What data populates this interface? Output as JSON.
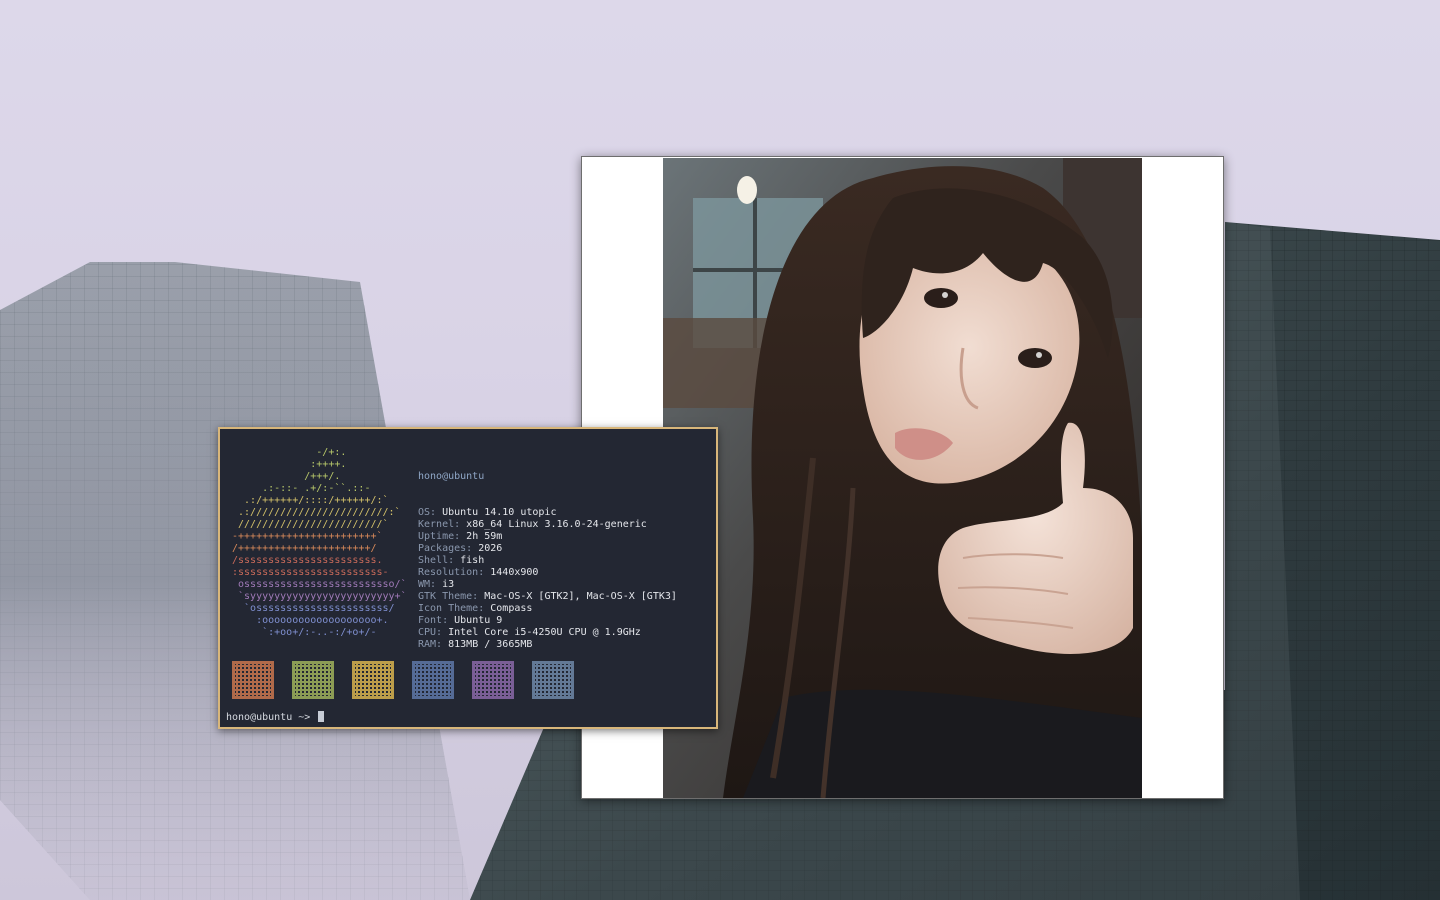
{
  "terminal": {
    "logo_lines": [
      "              -/+:.",
      "             :++++.",
      "            /+++/.",
      "     .:-::- .+/:-``.::-",
      "  .:/++++++/::::/++++++/:`",
      " .:///////////////////////:`",
      " ////////////////////////`",
      "-+++++++++++++++++++++++`",
      "/++++++++++++++++++++++/",
      "/sssssssssssssssssssssss.",
      ":ssssssssssssssssssssssss-",
      " osssssssssssssssssssssssso/`",
      " `syyyyyyyyyyyyyyyyyyyyyyyy+`",
      "  `ossssssssssssssssssssss/",
      "    :ooooooooooooooooooo+.",
      "     `:+oo+/:-..-:/+o+/-"
    ],
    "logo_colors": [
      "#b8c86a",
      "#b8c86a",
      "#b8c86a",
      "#b8c86a",
      "#d4c26a",
      "#d4c26a",
      "#d4c26a",
      "#d88a5a",
      "#d88a5a",
      "#c96a5a",
      "#c96a5a",
      "#a07ab8",
      "#a07ab8",
      "#7f8fd0",
      "#7f8fd0",
      "#7f8fd0"
    ],
    "header": "hono@ubuntu",
    "info": [
      {
        "key": "OS:",
        "value": "Ubuntu 14.10 utopic"
      },
      {
        "key": "Kernel:",
        "value": "x86_64 Linux 3.16.0-24-generic"
      },
      {
        "key": "Uptime:",
        "value": "2h 59m"
      },
      {
        "key": "Packages:",
        "value": "2026"
      },
      {
        "key": "Shell:",
        "value": "fish"
      },
      {
        "key": "Resolution:",
        "value": "1440x900"
      },
      {
        "key": "WM:",
        "value": "i3"
      },
      {
        "key": "GTK Theme:",
        "value": "Mac-OS-X [GTK2], Mac-OS-X [GTK3]"
      },
      {
        "key": "Icon Theme:",
        "value": "Compass"
      },
      {
        "key": "Font:",
        "value": "Ubuntu 9"
      },
      {
        "key": "CPU:",
        "value": "Intel Core i5-4250U CPU @ 1.9GHz"
      },
      {
        "key": "RAM:",
        "value": "813MB / 3665MB"
      }
    ],
    "palette_colors": [
      "#c9764f",
      "#9fb15b",
      "#d7b24f",
      "#5e78a8",
      "#8a68a8",
      "#6f88a8"
    ],
    "prompt": "hono@ubuntu ~>"
  },
  "colors": {
    "terminal_bg": "#232733",
    "terminal_border": "#d8b67a",
    "viewer_bg": "#ffffff"
  }
}
